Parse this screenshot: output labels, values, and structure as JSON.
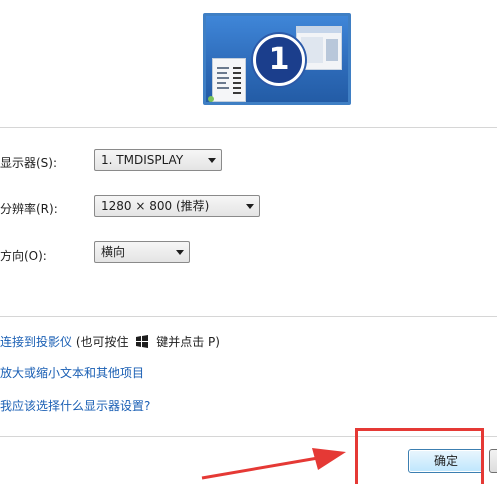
{
  "preview": {
    "monitor_number": "1"
  },
  "settings": {
    "display_label": "显示器(S):",
    "display_value": "1. TMDISPLAY",
    "resolution_label": "分辨率(R):",
    "resolution_value": "1280 × 800 (推荐)",
    "orientation_label": "方向(O):",
    "orientation_value": "横向"
  },
  "links": {
    "projector": "连接到投影仪",
    "projector_hint_before": "(也可按住",
    "projector_hint_after": "键并点击 P)",
    "text_size": "放大或缩小文本和其他项目",
    "which_settings": "我应该选择什么显示器设置?"
  },
  "buttons": {
    "ok": "确定"
  },
  "colors": {
    "link": "#1a5fb4",
    "highlight": "#e53935",
    "monitor_bg": "#2d6ab8"
  }
}
